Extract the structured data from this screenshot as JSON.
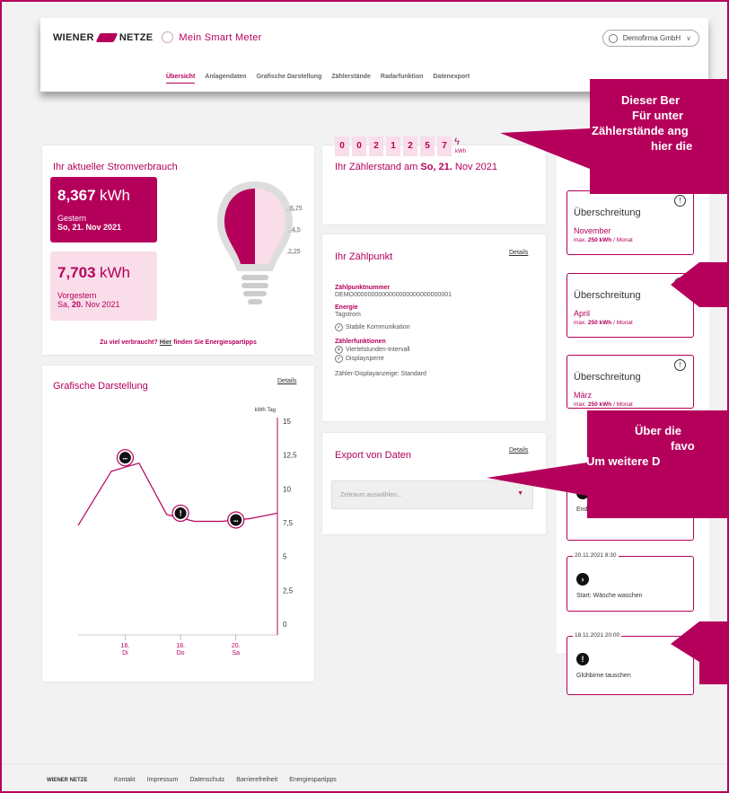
{
  "header": {
    "brand": "WIENER",
    "brand2": "NETZE",
    "app_title": "Mein Smart Meter",
    "user": "Demofirma GmbH",
    "nav": [
      "Übersicht",
      "Anlagendaten",
      "Grafische Darstellung",
      "Zählerstände",
      "Radarfunktion",
      "Datenexport"
    ],
    "active_nav": "Übersicht"
  },
  "consumption": {
    "title": "Ihr aktueller Stromverbrauch",
    "today_value": "8,367",
    "today_unit": "kWh",
    "today_label": "Gestern",
    "today_date_prefix": "So, ",
    "today_date_day": "21.",
    "today_date_rest": " Nov 2021",
    "prev_value": "7,703",
    "prev_unit": "kWh",
    "prev_label": "Vorgestern",
    "prev_date_prefix": "Sa, ",
    "prev_date_day": "20.",
    "prev_date_rest": " Nov 2021",
    "scale": [
      "6,75",
      "4,5",
      "2,25"
    ],
    "tip_prefix": "Zu viel verbraucht? ",
    "tip_link": "Hier",
    "tip_suffix": " finden Sie Energiespartipps"
  },
  "meter": {
    "title_prefix": "Ihr Zählerstand am ",
    "title_date": "So, 21.",
    "title_suffix": " Nov 2021",
    "digits": [
      "0",
      "0",
      "2",
      "1",
      "2",
      "5",
      "7"
    ],
    "unit": "kWh"
  },
  "zaehlpunkt": {
    "title": "Ihr Zählpunkt",
    "details": "Details",
    "nr_label": "Zählpunktnummer",
    "nr_value": "DEMO0000000000000000000000000001",
    "energy_label": "Energie",
    "energy_value": "Tagstrom",
    "comm": "Stabile Kommunikation",
    "functions_label": "Zählerfunktionen",
    "func1": "Viertelstunden-Intervall",
    "func2": "Displaysperre",
    "display": "Zähler-Displayanzeige: Standard"
  },
  "export": {
    "title": "Export von Daten",
    "details": "Details",
    "placeholder": "Zeitraum auswählen..."
  },
  "chart_card": {
    "title": "Grafische Darstellung",
    "details": "Details"
  },
  "chart_data": {
    "type": "line",
    "ylabel": "kWh Tag",
    "ylim": [
      0,
      15
    ],
    "yticks": [
      "15",
      "12,5",
      "10",
      "7,5",
      "5",
      "2,5",
      "0"
    ],
    "x_labels": [
      {
        "day": "16.",
        "wd": "Di"
      },
      {
        "day": "18.",
        "wd": "Do"
      },
      {
        "day": "20.",
        "wd": "Sa"
      }
    ],
    "series": [
      {
        "x": [
          14.3,
          15.5,
          16.5,
          17.5,
          18.5,
          19.5,
          20.5,
          21.5
        ],
        "values": [
          7.3,
          11.3,
          11.9,
          8.1,
          7.6,
          7.6,
          7.8,
          8.2
        ]
      }
    ],
    "markers": [
      {
        "x": 16,
        "y": 12.3,
        "icon": "more"
      },
      {
        "x": 18,
        "y": 8.2,
        "icon": "alert"
      },
      {
        "x": 20,
        "y": 7.7,
        "icon": "more"
      }
    ]
  },
  "side": {
    "limits": [
      {
        "title": "Überschreitung",
        "month": "November",
        "limit_prefix": "max. ",
        "limit_bold": "250 kWh",
        "limit_suffix": " / Monat"
      },
      {
        "title": "Überschreitung",
        "month": "April",
        "limit_prefix": "max. ",
        "limit_bold": "250 kWh",
        "limit_suffix": " / Monat"
      },
      {
        "title": "Überschreitung",
        "month": "März",
        "limit_prefix": "max. ",
        "limit_bold": "250 kWh",
        "limit_suffix": " / Monat"
      }
    ],
    "events": [
      {
        "ts": "",
        "icon": "◼",
        "text": "Ende: Wäsche waschen"
      },
      {
        "ts": "20.11.2021 8:30",
        "icon": "›",
        "text": "Start: Wäsche waschen"
      },
      {
        "ts": "18.11.2021 20:00",
        "icon": "!",
        "text": "Glühbirne tauschen"
      }
    ]
  },
  "callouts": {
    "top_lines": [
      "Dieser Ber",
      "Für unter",
      "Zählerstände ang",
      "hier die"
    ],
    "mid_lines": [
      "Über die",
      "favo",
      "Um weitere D"
    ]
  },
  "footer": {
    "brand": "WIENER NETZE",
    "links": [
      "Kontakt",
      "Impressum",
      "Datenschutz",
      "Barrierefreiheit",
      "Energiespartipps"
    ]
  },
  "colors": {
    "accent": "#b5005b",
    "accent_light": "#f9dde9"
  }
}
